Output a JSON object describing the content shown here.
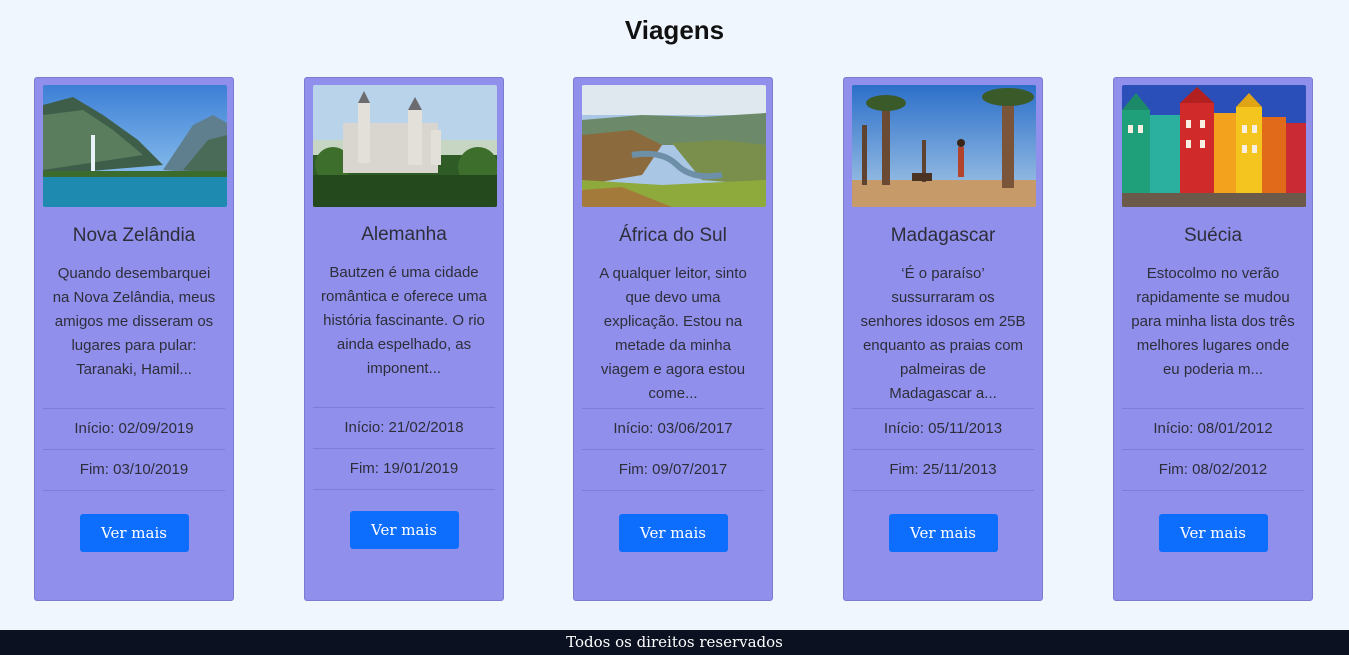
{
  "page": {
    "title": "Viagens"
  },
  "cards": [
    {
      "name": "Nova Zelândia",
      "description": "Quando desembarquei na Nova Zelândia, meus amigos me disseram os lugares para pular: Taranaki, Hamil...",
      "start": "Início: 02/09/2019",
      "end": "Fim: 03/10/2019",
      "button": "Ver mais",
      "image_icon": "mountain-lake-photo"
    },
    {
      "name": "Alemanha",
      "description": "Bautzen é uma cidade romântica e oferece uma história fascinante. O rio ainda espelhado, as imponent...",
      "start": "Início: 21/02/2018",
      "end": "Fim: 19/01/2019",
      "button": "Ver mais",
      "image_icon": "castle-photo"
    },
    {
      "name": "África do Sul",
      "description": "A qualquer leitor, sinto que devo uma explicação. Estou na metade da minha viagem e agora estou come...",
      "start": "Início: 03/06/2017",
      "end": "Fim: 09/07/2017",
      "button": "Ver mais",
      "image_icon": "canyon-photo"
    },
    {
      "name": "Madagascar",
      "description": "‘É o paraíso’ sussurraram os senhores idosos em 25B enquanto as praias com palmeiras de Madagascar a...",
      "start": "Início: 05/11/2013",
      "end": "Fim: 25/11/2013",
      "button": "Ver mais",
      "image_icon": "baobab-photo"
    },
    {
      "name": "Suécia",
      "description": "Estocolmo no verão rapidamente se mudou para minha lista dos três melhores lugares onde eu poderia m...",
      "start": "Início: 08/01/2012",
      "end": "Fim: 08/02/2012",
      "button": "Ver mais",
      "image_icon": "colorful-houses-photo"
    }
  ],
  "footer": {
    "text": "Todos os direitos reservados"
  },
  "colors": {
    "background": "#f0f6fe",
    "card": "#9090ec",
    "button": "#0d6efd",
    "footer": "#0b1120"
  }
}
